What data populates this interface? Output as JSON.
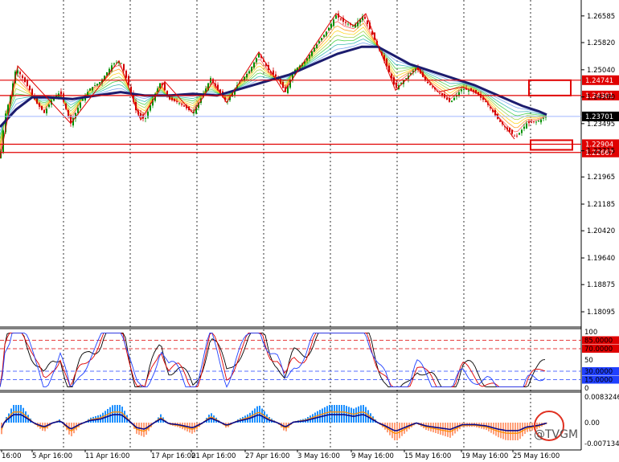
{
  "chart_data": {
    "type": "line",
    "price_axis": {
      "ticks": [
        "1.26585",
        "1.25820",
        "1.25040",
        "1.24260",
        "1.23495",
        "1.22715",
        "1.21965",
        "1.21185",
        "1.20420",
        "1.19640",
        "1.18875",
        "1.18095"
      ],
      "ylim": [
        1.1775,
        1.2695
      ]
    },
    "levels": [
      {
        "label": "1.24741",
        "value": 1.24741,
        "kind": "resistance",
        "color": "#e00000"
      },
      {
        "label": "1.24301",
        "value": 1.24301,
        "kind": "resistance",
        "color": "#e00000"
      },
      {
        "label": "1.23701",
        "value": 1.23701,
        "kind": "current",
        "color": "#000000"
      },
      {
        "label": "1.22904",
        "value": 1.22904,
        "kind": "support",
        "color": "#e00000"
      },
      {
        "label": "1.22667",
        "value": 1.22667,
        "kind": "support",
        "color": "#e00000"
      }
    ],
    "time_labels": [
      "16:00",
      "5 Apr 16:00",
      "11 Apr 16:00",
      "17 Apr 16:00",
      "21 Apr 16:00",
      "27 Apr 16:00",
      "3 May 16:00",
      "9 May 16:00",
      "15 May 16:00",
      "19 May 16:00",
      "25 May 16:00"
    ],
    "price_path": [
      [
        0,
        1.225
      ],
      [
        6,
        1.237
      ],
      [
        12,
        1.242
      ],
      [
        20,
        1.251
      ],
      [
        28,
        1.248
      ],
      [
        36,
        1.245
      ],
      [
        45,
        1.241
      ],
      [
        55,
        1.238
      ],
      [
        65,
        1.242
      ],
      [
        75,
        1.244
      ],
      [
        88,
        1.235
      ],
      [
        100,
        1.241
      ],
      [
        112,
        1.245
      ],
      [
        125,
        1.247
      ],
      [
        140,
        1.252
      ],
      [
        150,
        1.253
      ],
      [
        160,
        1.246
      ],
      [
        170,
        1.238
      ],
      [
        180,
        1.236
      ],
      [
        190,
        1.242
      ],
      [
        200,
        1.247
      ],
      [
        210,
        1.242
      ],
      [
        222,
        1.241
      ],
      [
        240,
        1.238
      ],
      [
        252,
        1.243
      ],
      [
        262,
        1.248
      ],
      [
        270,
        1.245
      ],
      [
        282,
        1.241
      ],
      [
        295,
        1.246
      ],
      [
        310,
        1.25
      ],
      [
        322,
        1.255
      ],
      [
        335,
        1.25
      ],
      [
        345,
        1.248
      ],
      [
        355,
        1.244
      ],
      [
        365,
        1.25
      ],
      [
        380,
        1.253
      ],
      [
        395,
        1.258
      ],
      [
        408,
        1.262
      ],
      [
        418,
        1.266
      ],
      [
        428,
        1.264
      ],
      [
        440,
        1.263
      ],
      [
        452,
        1.266
      ],
      [
        460,
        1.262
      ],
      [
        470,
        1.257
      ],
      [
        480,
        1.252
      ],
      [
        492,
        1.245
      ],
      [
        505,
        1.248
      ],
      [
        518,
        1.251
      ],
      [
        530,
        1.247
      ],
      [
        545,
        1.244
      ],
      [
        560,
        1.241
      ],
      [
        575,
        1.245
      ],
      [
        590,
        1.244
      ],
      [
        605,
        1.241
      ],
      [
        620,
        1.236
      ],
      [
        632,
        1.233
      ],
      [
        642,
        1.231
      ],
      [
        655,
        1.235
      ],
      [
        668,
        1.2355
      ],
      [
        680,
        1.237
      ]
    ],
    "ma_path": [
      [
        0,
        1.234
      ],
      [
        20,
        1.239
      ],
      [
        40,
        1.2425
      ],
      [
        60,
        1.2425
      ],
      [
        90,
        1.242
      ],
      [
        120,
        1.243
      ],
      [
        150,
        1.244
      ],
      [
        180,
        1.243
      ],
      [
        210,
        1.243
      ],
      [
        240,
        1.2435
      ],
      [
        270,
        1.243
      ],
      [
        300,
        1.245
      ],
      [
        330,
        1.247
      ],
      [
        360,
        1.249
      ],
      [
        390,
        1.252
      ],
      [
        420,
        1.255
      ],
      [
        450,
        1.257
      ],
      [
        470,
        1.257
      ],
      [
        490,
        1.2545
      ],
      [
        510,
        1.252
      ],
      [
        530,
        1.2505
      ],
      [
        550,
        1.249
      ],
      [
        570,
        1.2475
      ],
      [
        590,
        1.246
      ],
      [
        610,
        1.244
      ],
      [
        630,
        1.242
      ],
      [
        650,
        1.24
      ],
      [
        670,
        1.2385
      ],
      [
        680,
        1.2375
      ]
    ],
    "zigzag": [
      [
        0,
        1.225
      ],
      [
        22,
        1.2515
      ],
      [
        88,
        1.235
      ],
      [
        148,
        1.253
      ],
      [
        175,
        1.236
      ],
      [
        205,
        1.247
      ],
      [
        240,
        1.238
      ],
      [
        265,
        1.247
      ],
      [
        282,
        1.241
      ],
      [
        322,
        1.2555
      ],
      [
        353,
        1.244
      ],
      [
        418,
        1.2665
      ],
      [
        440,
        1.263
      ],
      [
        455,
        1.2665
      ],
      [
        492,
        1.2445
      ],
      [
        520,
        1.251
      ],
      [
        545,
        1.244
      ],
      [
        575,
        1.2455
      ],
      [
        600,
        1.243
      ],
      [
        640,
        1.2305
      ]
    ],
    "stochastic": {
      "ticks": [
        "100",
        "85.0000",
        "70.0000",
        "50",
        "30.0000",
        "15.0000",
        "0"
      ],
      "series": [
        {
          "name": "main",
          "color": "#000000"
        },
        {
          "name": "signal",
          "color": "#e00000"
        },
        {
          "name": "avg",
          "color": "#2040ff"
        }
      ]
    },
    "macd": {
      "ticks": [
        "0.0083246",
        "0.00",
        "-0.0071348"
      ],
      "hist_colors": {
        "positive": "#1e90ff",
        "negative": "#ffa07a"
      },
      "line_colors": {
        "signal": "#0a0a8a",
        "fast": "#ff8c00"
      }
    }
  },
  "watermark": {
    "text": "@TVGM"
  },
  "colors": {
    "grid": "#000000",
    "background": "#ffffff",
    "level": "#e00000",
    "current": "#a0b8ff",
    "ma": "#1c1c6e"
  }
}
